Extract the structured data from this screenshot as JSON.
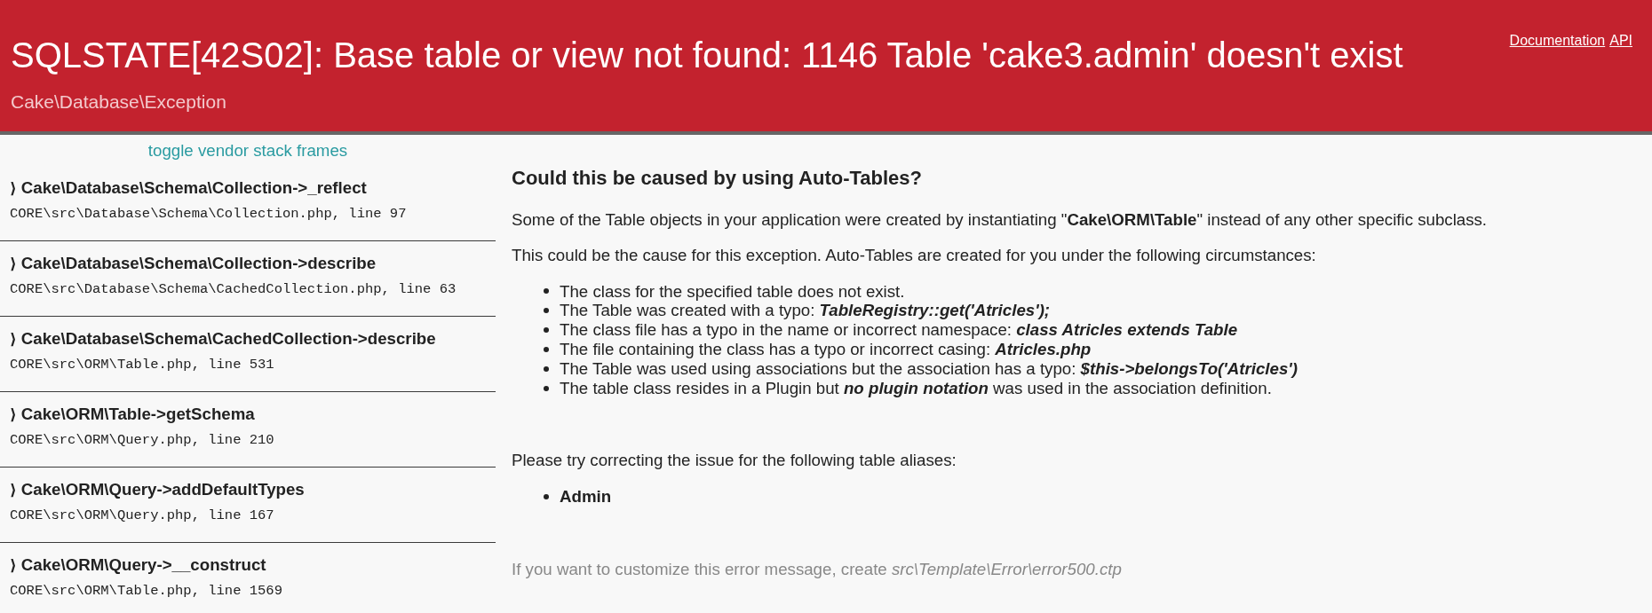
{
  "header": {
    "title": "SQLSTATE[42S02]: Base table or view not found: 1146 Table 'cake3.admin' doesn't exist",
    "exception_class": "Cake\\Database\\Exception",
    "links": [
      "Documentation",
      "API"
    ]
  },
  "stack_trace": {
    "toggle_link": "toggle vendor stack frames",
    "frames": [
      {
        "marker": "⟩",
        "function": "Cake\\Database\\Schema\\Collection->_reflect",
        "location": "CORE\\src\\Database\\Schema\\Collection.php, line 97"
      },
      {
        "marker": "⟩",
        "function": "Cake\\Database\\Schema\\Collection->describe",
        "location": "CORE\\src\\Database\\Schema\\CachedCollection.php, line 63"
      },
      {
        "marker": "⟩",
        "function": "Cake\\Database\\Schema\\CachedCollection->describe",
        "location": "CORE\\src\\ORM\\Table.php, line 531"
      },
      {
        "marker": "⟩",
        "function": "Cake\\ORM\\Table->getSchema",
        "location": "CORE\\src\\ORM\\Query.php, line 210"
      },
      {
        "marker": "⟩",
        "function": "Cake\\ORM\\Query->addDefaultTypes",
        "location": "CORE\\src\\ORM\\Query.php, line 167"
      },
      {
        "marker": "⟩",
        "function": "Cake\\ORM\\Query->__construct",
        "location": "CORE\\src\\ORM\\Table.php, line 1569"
      }
    ]
  },
  "content": {
    "heading": "Could this be caused by using Auto-Tables?",
    "paragraphs": [
      "Some of the Table objects in your application were created by instantiating \"**Cake\\ORM\\Table**\" instead of any other specific subclass.",
      "This could be the cause for this exception. Auto-Tables are created for you under the following circumstances:"
    ],
    "circumstances": [
      "The class for the specified table does not exist.",
      "The Table was created with a typo: **TableRegistry::get('Atricles');**",
      "The class file has a typo in the name or incorrect namespace: **class Atricles extends Table**",
      "The file containing the class has a typo or incorrect casing: **Atricles.php**",
      "The Table was used using associations but the association has a typo: **$this->belongsTo('Atricles')**",
      "The table class resides in a Plugin but **no plugin notation** was used in the association definition."
    ],
    "aliases_intro": "Please try correcting the issue for the following table aliases:",
    "aliases": [
      "Admin"
    ],
    "footer": "If you want to customize this error message, create *src\\Template\\Error\\error500.ctp*"
  }
}
